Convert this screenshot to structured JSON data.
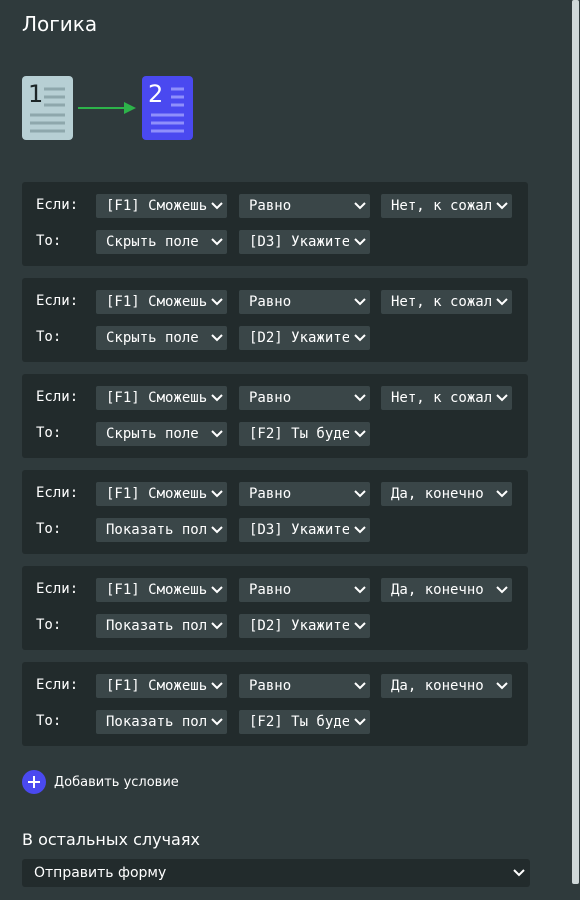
{
  "title": "Логика",
  "pages": {
    "from": "1",
    "to": "2"
  },
  "labels": {
    "if": "Если:",
    "then": "То:"
  },
  "rules": [
    {
      "field": "[F1] Сможешь",
      "operator": "Равно",
      "value": "Нет, к сожал",
      "action": "Скрыть поле",
      "target": "[D3] Укажите"
    },
    {
      "field": "[F1] Сможешь",
      "operator": "Равно",
      "value": "Нет, к сожал",
      "action": "Скрыть поле",
      "target": "[D2] Укажите"
    },
    {
      "field": "[F1] Сможешь",
      "operator": "Равно",
      "value": "Нет, к сожал",
      "action": "Скрыть поле",
      "target": "[F2] Ты буде"
    },
    {
      "field": "[F1] Сможешь",
      "operator": "Равно",
      "value": "Да, конечно",
      "action": "Показать пол",
      "target": "[D3] Укажите"
    },
    {
      "field": "[F1] Сможешь",
      "operator": "Равно",
      "value": "Да, конечно",
      "action": "Показать пол",
      "target": "[D2] Укажите"
    },
    {
      "field": "[F1] Сможешь",
      "operator": "Равно",
      "value": "Да, конечно",
      "action": "Показать пол",
      "target": "[F2] Ты буде"
    }
  ],
  "add_condition": "Добавить условие",
  "otherwise": {
    "title": "В остальных случаях",
    "value": "Отправить форму"
  },
  "colors": {
    "accent": "#4a49f0",
    "arrow": "#2db34a",
    "panel": "#222b2c",
    "background": "#2f3a3c"
  },
  "icons": {
    "chevron": "chevron-down-icon",
    "plus": "plus-icon",
    "page": "page-icon",
    "arrow": "arrow-right-icon"
  }
}
